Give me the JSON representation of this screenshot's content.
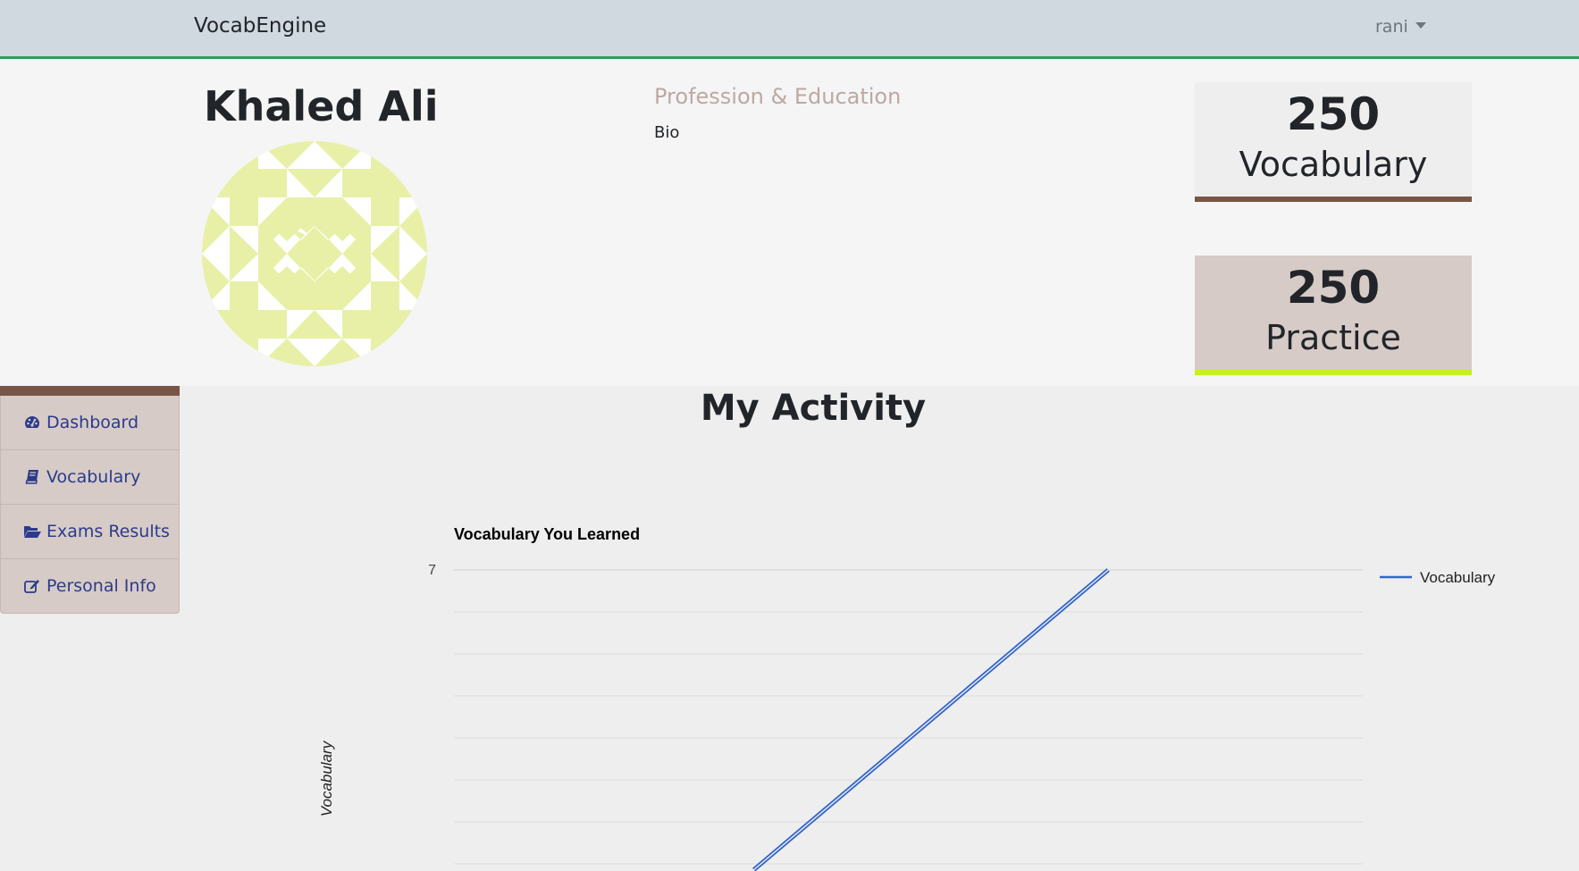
{
  "navbar": {
    "brand": "VocabEngine",
    "user": "rani"
  },
  "profile": {
    "name": "Khaled Ali",
    "profession_title": "Profession & Education",
    "bio": "Bio"
  },
  "stats": [
    {
      "value": "250",
      "label": "Vocabulary"
    },
    {
      "value": "250",
      "label": "Practice"
    }
  ],
  "sidebar": {
    "items": [
      {
        "label": "Dashboard",
        "icon": "dashboard-icon"
      },
      {
        "label": "Vocabulary",
        "icon": "book-icon"
      },
      {
        "label": "Exams Results",
        "icon": "folder-open-icon"
      },
      {
        "label": "Personal Info",
        "icon": "edit-icon"
      }
    ]
  },
  "activity": {
    "title": "My Activity"
  },
  "colors": {
    "navbar_bg": "#d0d8e0",
    "navbar_accent": "#2e9e5b",
    "brown_accent": "#795548",
    "lime_accent": "#c6f21b",
    "avatar_color": "#e8f0a8",
    "line_color": "#3366cc",
    "link_color": "#2b3b8c"
  },
  "chart_data": {
    "type": "line",
    "title": "Vocabulary You Learned",
    "ylabel": "Vocabulary",
    "xlabel": "",
    "legend": "top-right",
    "grid": true,
    "y_tick_labels": [
      "7"
    ],
    "series": [
      {
        "name": "Vocabulary",
        "points": [
          [
            0.33,
            0
          ],
          [
            0.72,
            7
          ]
        ]
      }
    ]
  }
}
